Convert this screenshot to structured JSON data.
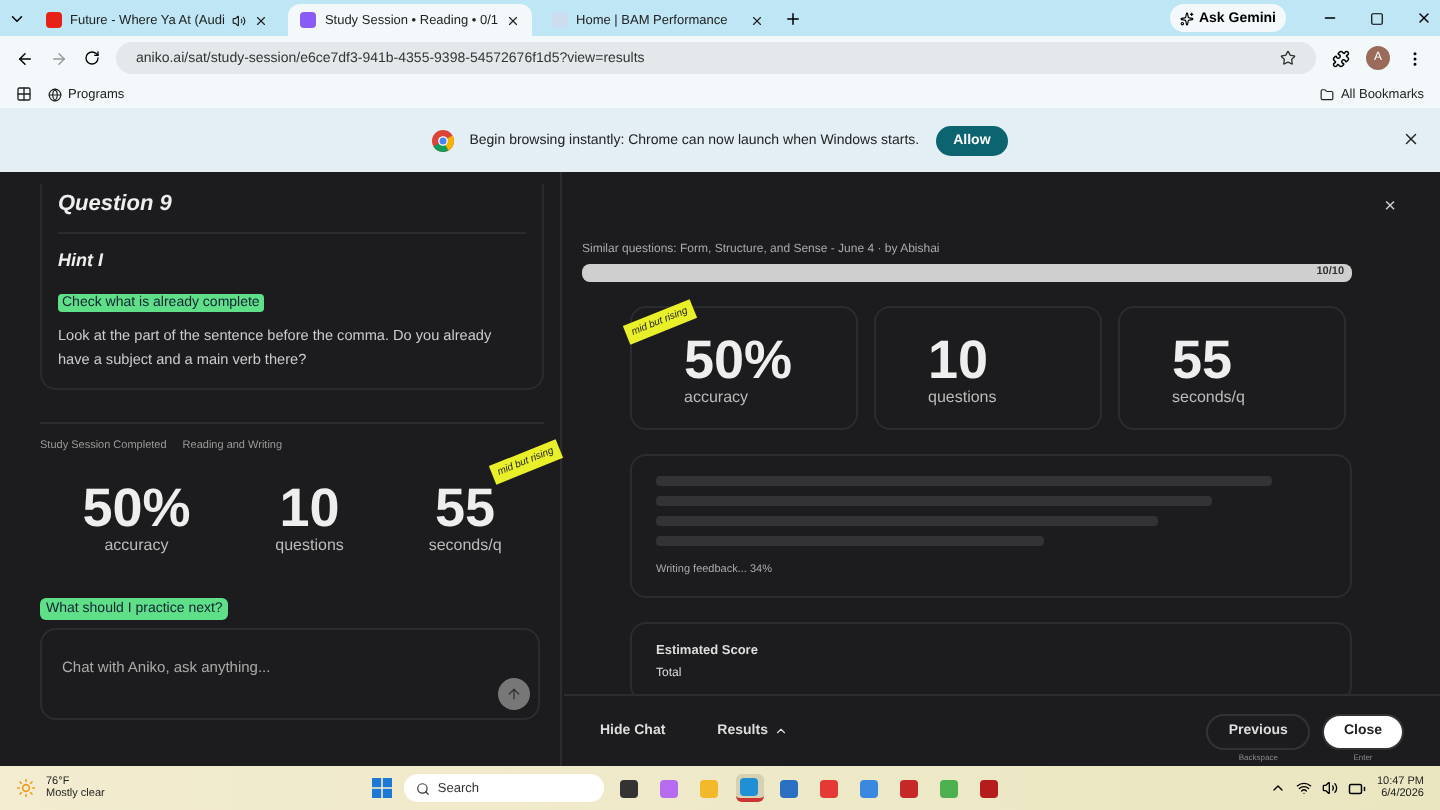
{
  "browser": {
    "tabs": [
      {
        "title": "Future - Where Ya At (Audi",
        "selected": false,
        "audio": true
      },
      {
        "title": "Study Session • Reading • 0/1",
        "selected": true,
        "audio": false
      },
      {
        "title": "Home | BAM Performance",
        "selected": false,
        "audio": false
      }
    ],
    "ask_button": "Ask Gemini",
    "url": "aniko.ai/sat/study-session/e6ce7df3-941b-4355-9398-54572676f1d5?view=results",
    "avatar": "A",
    "bookmarks": [
      "Programs"
    ],
    "all_bookmarks": "All Bookmarks",
    "infobar": {
      "message": "Begin browsing instantly: Chrome can now launch when Windows starts.",
      "button": "Allow"
    }
  },
  "left": {
    "question_title": "Question 9",
    "hint_title": "Hint I",
    "hint_highlight": "Check what is already complete",
    "hint_text": "Look at the part of the sentence before the comma. Do you already have a subject and a main verb there?",
    "session_label": "Study Session Completed",
    "session_subject": "Reading and Writing",
    "stats": [
      {
        "value": "50%",
        "label": "accuracy"
      },
      {
        "value": "10",
        "label": "questions"
      },
      {
        "value": "55",
        "label": "seconds/q",
        "sticker": "mid but rising"
      }
    ],
    "suggestion": "What should I practice next?",
    "chat_placeholder": "Chat with Aniko, ask anything..."
  },
  "right": {
    "close": "×",
    "similar": "Similar questions: Form, Structure, and Sense - June 4 · by Abishai",
    "progress": {
      "level": 1,
      "reading": "10/10"
    },
    "stats": [
      {
        "value": "50%",
        "label": "accuracy",
        "sticker": "mid but rising"
      },
      {
        "value": "10",
        "label": "questions"
      },
      {
        "value": "55",
        "label": "seconds/q"
      }
    ],
    "feedback_status": "Writing feedback... 34%",
    "estimated_title": "Estimated Score",
    "estimated_row": "Total"
  },
  "bottom_bar": {
    "hide_chat": "Hide Chat",
    "results": "Results",
    "previous": "Previous",
    "previous_hint": "Backspace",
    "close": "Close",
    "close_hint": "Enter"
  },
  "taskbar": {
    "temperature": "76°F",
    "weather": "Mostly clear",
    "search": "Search",
    "apps": [
      {
        "selected": false
      },
      {
        "selected": false
      },
      {
        "selected": false
      },
      {
        "selected": true
      },
      {
        "selected": false
      },
      {
        "selected": false
      },
      {
        "selected": false
      },
      {
        "selected": false
      },
      {
        "selected": false
      },
      {
        "selected": false
      }
    ],
    "time": "10:47 PM",
    "date": "6/4/2026"
  }
}
